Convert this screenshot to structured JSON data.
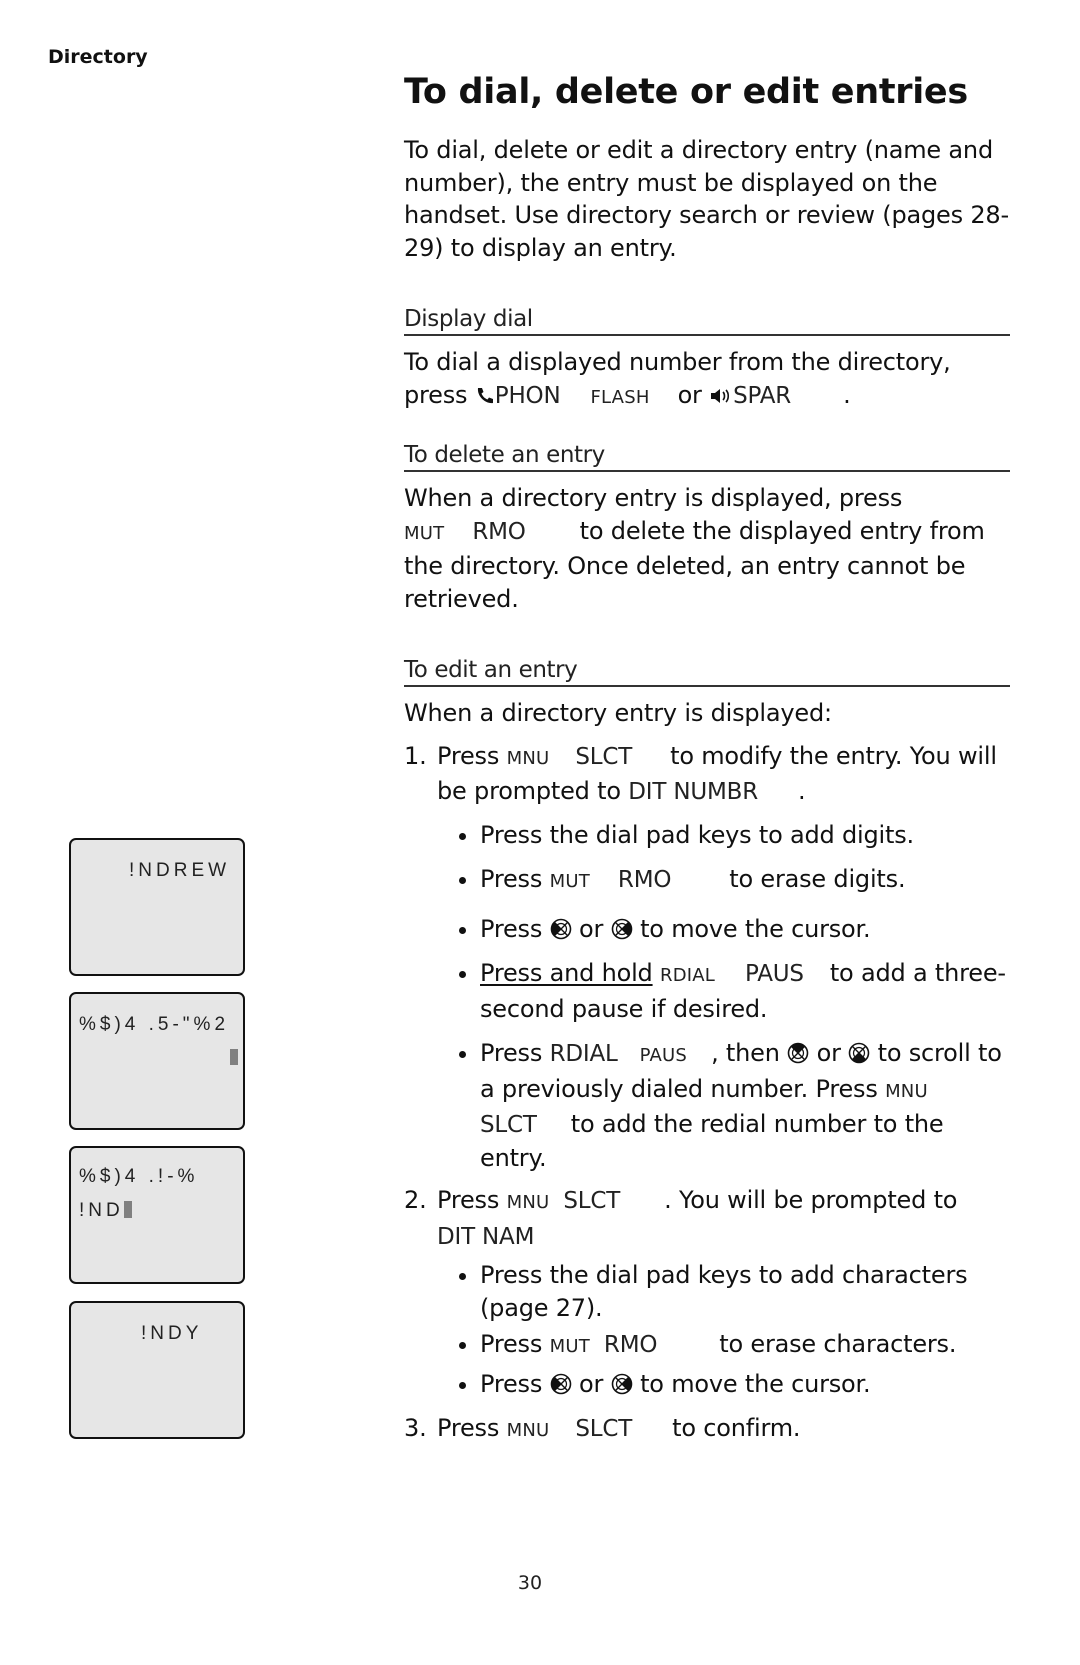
{
  "running_head": "Directory",
  "page_number": "30",
  "title": "To dial, delete or edit entries",
  "intro": "To dial, delete or edit a directory entry (name and number), the entry must be displayed on the handset. Use directory search or review (pages 28-29) to display an entry.",
  "display_dial": {
    "heading": "Display dial",
    "text_before": "To dial a displayed number from the directory, press",
    "key1_main": "PHON",
    "key1_sub": "FLASH",
    "or": "or",
    "key2_main": "SPAR",
    "end": "."
  },
  "delete": {
    "heading": "To delete an entry",
    "text_before": "When a directory entry is displayed, press",
    "key_sub": "MUT",
    "key_main": "RMO",
    "text_after": "to delete the displayed entry from the directory. Once deleted, an entry cannot be retrieved."
  },
  "edit": {
    "heading": "To edit an entry",
    "lead": "When a directory entry is displayed:",
    "step1": {
      "num": "1.",
      "press": "Press",
      "key_sub": "MNU",
      "key_main": "SLCT",
      "text_after": "to modify the entry. You will be prompted to",
      "prompt": "DIT NUMBR",
      "end": ".",
      "bullets": {
        "b1": "Press the dial pad keys to add digits.",
        "b2_press": "Press",
        "b2_key_sub": "MUT",
        "b2_key_main": "RMO",
        "b2_after": "to erase digits.",
        "b3_press": "Press",
        "b3_or": "or",
        "b3_after": "to move the cursor.",
        "b4_hold": "Press and hold",
        "b4_key_sub": "RDIAL",
        "b4_key_main": "PAUS",
        "b4_after": "to add a three-second pause if desired.",
        "b5_press": "Press",
        "b5_key_main": "RDIAL",
        "b5_key_sub": "PAUS",
        "b5_then": ", then",
        "b5_or": "or",
        "b5_after": "to scroll to a previously dialed number. Press",
        "b5_key2_sub": "MNU",
        "b5_key2_main": "SLCT",
        "b5_end": "to add the redial number to the entry."
      }
    },
    "step2": {
      "num": "2.",
      "press": "Press",
      "key_sub": "MNU",
      "key_main": "SLCT",
      "text_after": ". You will be prompted to",
      "prompt": "DIT NAM",
      "bullets": {
        "b1": "Press the dial pad keys to add characters (page 27).",
        "b2_press": "Press",
        "b2_key_sub": "MUT",
        "b2_key_main": "RMO",
        "b2_after": "to erase characters.",
        "b3_press": "Press",
        "b3_or": "or",
        "b3_after": "to move the cursor."
      }
    },
    "step3": {
      "num": "3.",
      "press": "Press",
      "key_sub": "MNU",
      "key_main": "SLCT",
      "text_after": "to confirm."
    }
  },
  "screens": [
    {
      "line1": "!NDREW",
      "line2": ""
    },
    {
      "line1": "%$)4 .5-\"%2",
      "line2": ""
    },
    {
      "line1": "%$)4 .!-%",
      "line2": "!ND"
    },
    {
      "line1": "!NDY",
      "line2": ""
    }
  ],
  "icons": {
    "phone": "phone-icon",
    "speaker": "speaker-icon",
    "nav_left": "nav-left-icon",
    "nav_right": "nav-right-icon",
    "nav_up": "nav-up-icon",
    "nav_down": "nav-down-icon"
  }
}
